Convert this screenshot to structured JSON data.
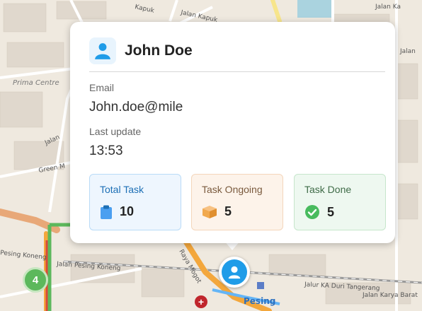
{
  "map": {
    "labels": {
      "prima_centre": "Prima Centre",
      "green": "Green M",
      "jalan_kapuk_1": "Jalan Kapuk",
      "jalan_kapuk_2": "Jalan Kapuk",
      "jalan_ka": "Jalan Ka",
      "jalan": "Jalan",
      "jalan_right": "Jalan",
      "pesing_konang": "Pesing Koneng",
      "jalan_pesing_koneng": "Jalan Pesing Koneng",
      "duri_tangerang_left": "Jalur KA Duri Tangerang",
      "duri_tangerang_right": "Jalur KA Duri Tangerang",
      "jalan_karya_barat": "Jalan Karya Barat",
      "pesing": "Pesing",
      "mogot": "Raya Mogot",
      "kapuk_top": "Kapuk"
    },
    "cluster_count": "4",
    "colors": {
      "cluster": "#5cb85c",
      "user_marker": "#1f9ce8",
      "hospital": "#c0262d",
      "road_orange": "#f3a73c",
      "rail_green": "#5cb85c"
    }
  },
  "popup": {
    "name": "John Doe",
    "email_label": "Email",
    "email_value": "John.doe@mile",
    "last_update_label": "Last update",
    "last_update_value": "13:53",
    "stats": [
      {
        "title": "Total Task",
        "icon": "clipboard-icon",
        "value": "10",
        "color": "#4a9ff0"
      },
      {
        "title": "Task Ongoing",
        "icon": "box-icon",
        "value": "5",
        "color": "#f1a94e"
      },
      {
        "title": "Task Done",
        "icon": "check-circle-icon",
        "value": "5",
        "color": "#48bb5e"
      }
    ]
  }
}
